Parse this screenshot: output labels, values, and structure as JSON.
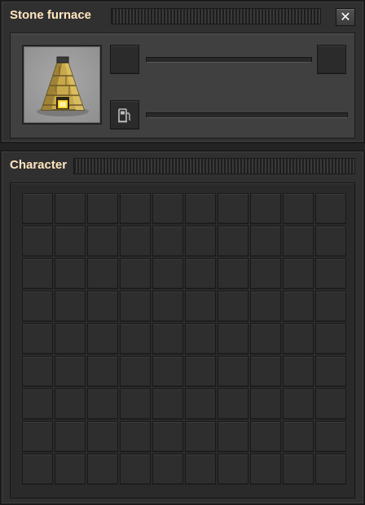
{
  "furnace_window": {
    "title": "Stone furnace",
    "close_label": "✕",
    "entity_icon": "stone-furnace-icon",
    "fuel_icon": "fuel-pump-icon",
    "slots": [
      "source-slot",
      "result-slot",
      "fuel-slot"
    ]
  },
  "character_window": {
    "title": "Character",
    "rows": 9,
    "columns": 10
  },
  "colors": {
    "title_text": "#ffe6c0",
    "frame": "#313031",
    "slot": "#2f2e2f"
  }
}
